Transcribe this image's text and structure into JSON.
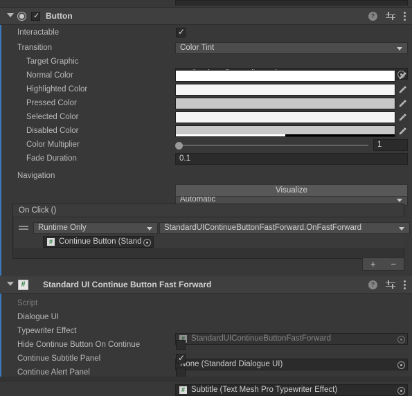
{
  "window": {
    "background": "#383838",
    "selection_stripe_color": "#3a79bb"
  },
  "components": [
    {
      "title": "Button",
      "icon": "toggle-circle-icon",
      "enabled": true,
      "expanded": true,
      "header_icons": [
        "help-icon",
        "preset-icon",
        "menu-icon"
      ],
      "rows": [
        {
          "label": "Interactable",
          "type": "checkbox",
          "value": true
        },
        {
          "label": "Transition",
          "type": "dropdown",
          "value": "Color Tint"
        },
        {
          "label": "Target Graphic",
          "type": "object",
          "value": "Continue Button (Image)",
          "icon": "image-icon",
          "indent": 1
        },
        {
          "label": "Normal Color",
          "type": "color",
          "color": "#ffffff",
          "alpha": 100,
          "indent": 1
        },
        {
          "label": "Highlighted Color",
          "type": "color",
          "color": "#f5f5f5",
          "alpha": 100,
          "indent": 1
        },
        {
          "label": "Pressed Color",
          "type": "color",
          "color": "#c8c8c8",
          "alpha": 100,
          "indent": 1
        },
        {
          "label": "Selected Color",
          "type": "color",
          "color": "#f5f5f5",
          "alpha": 100,
          "indent": 1
        },
        {
          "label": "Disabled Color",
          "type": "color",
          "color": "#c8c8c8",
          "alpha": 50,
          "indent": 1
        },
        {
          "label": "Color Multiplier",
          "type": "slider",
          "value": "1",
          "percent": 0,
          "indent": 1
        },
        {
          "label": "Fade Duration",
          "type": "text",
          "value": "0.1",
          "indent": 1
        },
        {
          "label": "Navigation",
          "type": "dropdown",
          "value": "Automatic"
        }
      ],
      "visualize_button": "Visualize",
      "event": {
        "title": "On Click ()",
        "entries": [
          {
            "mode": "Runtime Only",
            "function": "StandardUIContinueButtonFastForward.OnFastForward",
            "object": "Continue Button (Stand",
            "object_icon": "cs-script-icon"
          }
        ],
        "add_label": "+",
        "remove_label": "−"
      }
    },
    {
      "title": "Standard UI Continue Button Fast Forward",
      "icon": "cs-script-icon",
      "expanded": true,
      "header_icons": [
        "help-icon",
        "preset-icon",
        "menu-icon"
      ],
      "rows": [
        {
          "label": "Script",
          "type": "object",
          "value": "StandardUIContinueButtonFastForward",
          "icon": "cs-script-icon",
          "disabled": true
        },
        {
          "label": "Dialogue UI",
          "type": "object",
          "value": "None (Standard Dialogue UI)",
          "icon": "none"
        },
        {
          "label": "Typewriter Effect",
          "type": "object",
          "value": "Subtitle (Text Mesh Pro Typewriter Effect)",
          "icon": "cs-script-icon"
        },
        {
          "label": "Hide Continue Button On Continue",
          "type": "checkbox",
          "value": false
        },
        {
          "label": "Continue Subtitle Panel",
          "type": "checkbox",
          "value": true
        },
        {
          "label": "Continue Alert Panel",
          "type": "checkbox",
          "value": false
        }
      ]
    }
  ]
}
